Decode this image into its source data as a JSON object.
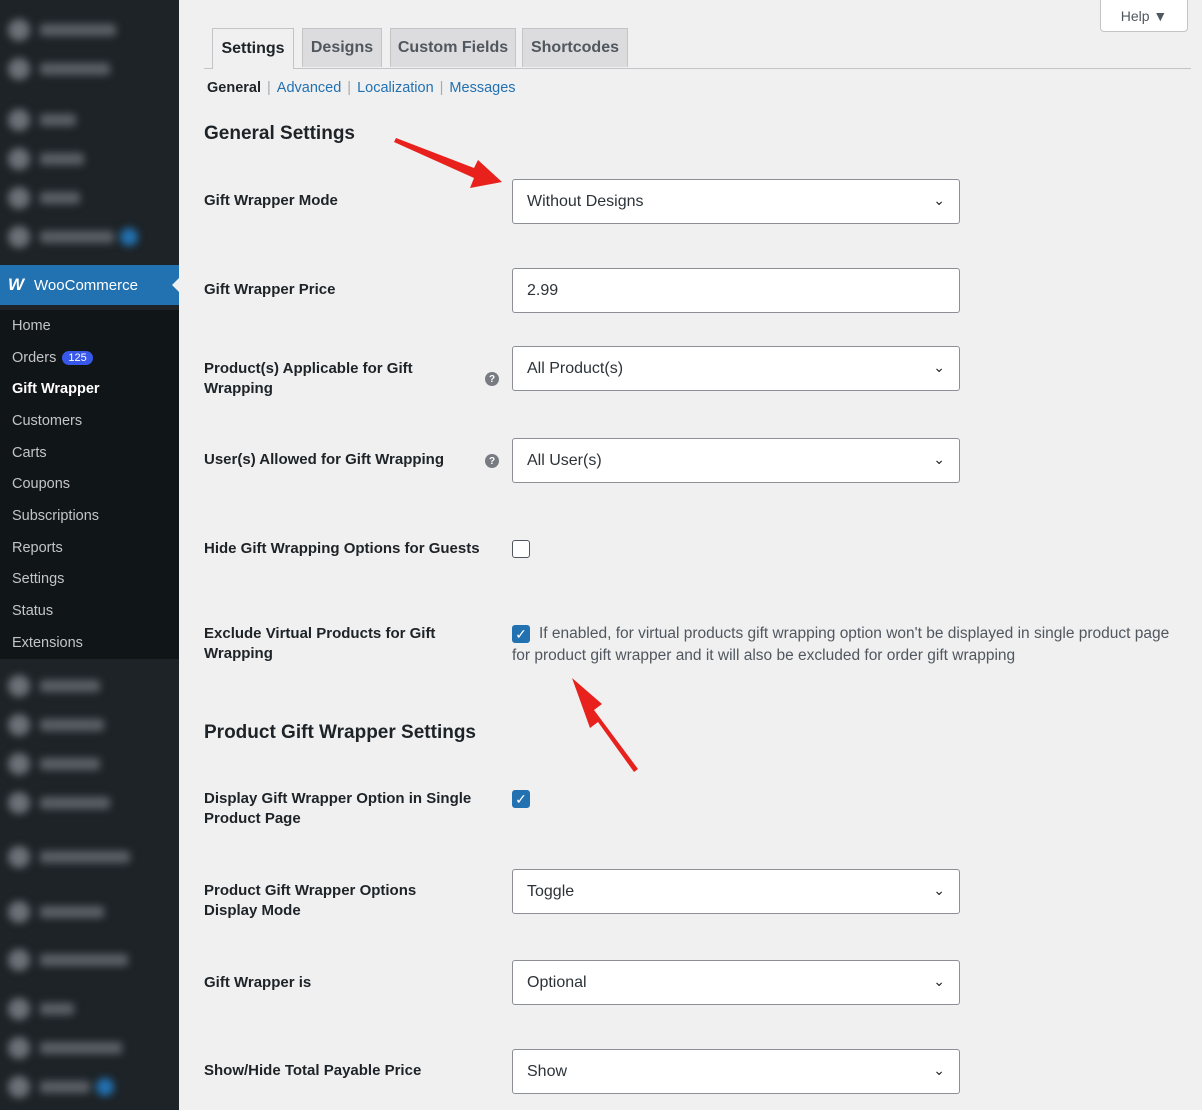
{
  "sidebar": {
    "brand": "WooCommerce",
    "submenu": [
      {
        "label": "Home"
      },
      {
        "label": "Orders",
        "badge": "125"
      },
      {
        "label": "Gift Wrapper",
        "current": true
      },
      {
        "label": "Customers"
      },
      {
        "label": "Carts"
      },
      {
        "label": "Coupons"
      },
      {
        "label": "Subscriptions"
      },
      {
        "label": "Reports"
      },
      {
        "label": "Settings"
      },
      {
        "label": "Status"
      },
      {
        "label": "Extensions"
      }
    ]
  },
  "help": {
    "label": "Help ▼"
  },
  "tabs": [
    {
      "label": "Settings",
      "active": true
    },
    {
      "label": "Designs"
    },
    {
      "label": "Custom Fields"
    },
    {
      "label": "Shortcodes"
    }
  ],
  "subnav": {
    "current": "General",
    "links": [
      "Advanced",
      "Localization",
      "Messages"
    ],
    "separator": "|"
  },
  "general": {
    "heading": "General Settings",
    "mode_label": "Gift Wrapper Mode",
    "mode_value": "Without Designs",
    "price_label": "Gift Wrapper Price",
    "price_value": "2.99",
    "products_label": "Product(s) Applicable for Gift Wrapping",
    "products_value": "All Product(s)",
    "users_label": "User(s) Allowed for Gift Wrapping",
    "users_value": "All User(s)",
    "hide_guests_label": "Hide Gift Wrapping Options for Guests",
    "hide_guests_checked": false,
    "exclude_virtual_label": "Exclude Virtual Products for Gift Wrapping",
    "exclude_virtual_checked": true,
    "exclude_virtual_desc": "If enabled, for virtual products gift wrapping option won't be displayed in single product page for product gift wrapper and it will also be excluded for order gift wrapping"
  },
  "product": {
    "heading": "Product Gift Wrapper Settings",
    "display_single_label": "Display Gift Wrapper Option in Single Product Page",
    "display_single_checked": true,
    "display_mode_label": "Product Gift Wrapper Options Display Mode",
    "display_mode_value": "Toggle",
    "is_label": "Gift Wrapper is",
    "is_value": "Optional",
    "total_label": "Show/Hide Total Payable Price",
    "total_value": "Show"
  },
  "icons": {
    "question": "?",
    "chevron": "⌄",
    "check": "✓"
  },
  "colors": {
    "accent": "#2271b1",
    "arrow": "#e8211c"
  }
}
